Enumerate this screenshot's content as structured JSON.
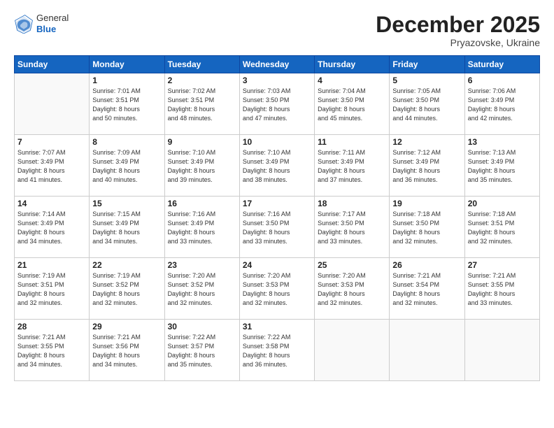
{
  "header": {
    "logo": {
      "general": "General",
      "blue": "Blue"
    },
    "title": "December 2025",
    "location": "Pryazovske, Ukraine"
  },
  "weekdays": [
    "Sunday",
    "Monday",
    "Tuesday",
    "Wednesday",
    "Thursday",
    "Friday",
    "Saturday"
  ],
  "weeks": [
    [
      {
        "day": "",
        "info": ""
      },
      {
        "day": "1",
        "info": "Sunrise: 7:01 AM\nSunset: 3:51 PM\nDaylight: 8 hours\nand 50 minutes."
      },
      {
        "day": "2",
        "info": "Sunrise: 7:02 AM\nSunset: 3:51 PM\nDaylight: 8 hours\nand 48 minutes."
      },
      {
        "day": "3",
        "info": "Sunrise: 7:03 AM\nSunset: 3:50 PM\nDaylight: 8 hours\nand 47 minutes."
      },
      {
        "day": "4",
        "info": "Sunrise: 7:04 AM\nSunset: 3:50 PM\nDaylight: 8 hours\nand 45 minutes."
      },
      {
        "day": "5",
        "info": "Sunrise: 7:05 AM\nSunset: 3:50 PM\nDaylight: 8 hours\nand 44 minutes."
      },
      {
        "day": "6",
        "info": "Sunrise: 7:06 AM\nSunset: 3:49 PM\nDaylight: 8 hours\nand 42 minutes."
      }
    ],
    [
      {
        "day": "7",
        "info": "Sunrise: 7:07 AM\nSunset: 3:49 PM\nDaylight: 8 hours\nand 41 minutes."
      },
      {
        "day": "8",
        "info": "Sunrise: 7:09 AM\nSunset: 3:49 PM\nDaylight: 8 hours\nand 40 minutes."
      },
      {
        "day": "9",
        "info": "Sunrise: 7:10 AM\nSunset: 3:49 PM\nDaylight: 8 hours\nand 39 minutes."
      },
      {
        "day": "10",
        "info": "Sunrise: 7:10 AM\nSunset: 3:49 PM\nDaylight: 8 hours\nand 38 minutes."
      },
      {
        "day": "11",
        "info": "Sunrise: 7:11 AM\nSunset: 3:49 PM\nDaylight: 8 hours\nand 37 minutes."
      },
      {
        "day": "12",
        "info": "Sunrise: 7:12 AM\nSunset: 3:49 PM\nDaylight: 8 hours\nand 36 minutes."
      },
      {
        "day": "13",
        "info": "Sunrise: 7:13 AM\nSunset: 3:49 PM\nDaylight: 8 hours\nand 35 minutes."
      }
    ],
    [
      {
        "day": "14",
        "info": "Sunrise: 7:14 AM\nSunset: 3:49 PM\nDaylight: 8 hours\nand 34 minutes."
      },
      {
        "day": "15",
        "info": "Sunrise: 7:15 AM\nSunset: 3:49 PM\nDaylight: 8 hours\nand 34 minutes."
      },
      {
        "day": "16",
        "info": "Sunrise: 7:16 AM\nSunset: 3:49 PM\nDaylight: 8 hours\nand 33 minutes."
      },
      {
        "day": "17",
        "info": "Sunrise: 7:16 AM\nSunset: 3:50 PM\nDaylight: 8 hours\nand 33 minutes."
      },
      {
        "day": "18",
        "info": "Sunrise: 7:17 AM\nSunset: 3:50 PM\nDaylight: 8 hours\nand 33 minutes."
      },
      {
        "day": "19",
        "info": "Sunrise: 7:18 AM\nSunset: 3:50 PM\nDaylight: 8 hours\nand 32 minutes."
      },
      {
        "day": "20",
        "info": "Sunrise: 7:18 AM\nSunset: 3:51 PM\nDaylight: 8 hours\nand 32 minutes."
      }
    ],
    [
      {
        "day": "21",
        "info": "Sunrise: 7:19 AM\nSunset: 3:51 PM\nDaylight: 8 hours\nand 32 minutes."
      },
      {
        "day": "22",
        "info": "Sunrise: 7:19 AM\nSunset: 3:52 PM\nDaylight: 8 hours\nand 32 minutes."
      },
      {
        "day": "23",
        "info": "Sunrise: 7:20 AM\nSunset: 3:52 PM\nDaylight: 8 hours\nand 32 minutes."
      },
      {
        "day": "24",
        "info": "Sunrise: 7:20 AM\nSunset: 3:53 PM\nDaylight: 8 hours\nand 32 minutes."
      },
      {
        "day": "25",
        "info": "Sunrise: 7:20 AM\nSunset: 3:53 PM\nDaylight: 8 hours\nand 32 minutes."
      },
      {
        "day": "26",
        "info": "Sunrise: 7:21 AM\nSunset: 3:54 PM\nDaylight: 8 hours\nand 32 minutes."
      },
      {
        "day": "27",
        "info": "Sunrise: 7:21 AM\nSunset: 3:55 PM\nDaylight: 8 hours\nand 33 minutes."
      }
    ],
    [
      {
        "day": "28",
        "info": "Sunrise: 7:21 AM\nSunset: 3:55 PM\nDaylight: 8 hours\nand 34 minutes."
      },
      {
        "day": "29",
        "info": "Sunrise: 7:21 AM\nSunset: 3:56 PM\nDaylight: 8 hours\nand 34 minutes."
      },
      {
        "day": "30",
        "info": "Sunrise: 7:22 AM\nSunset: 3:57 PM\nDaylight: 8 hours\nand 35 minutes."
      },
      {
        "day": "31",
        "info": "Sunrise: 7:22 AM\nSunset: 3:58 PM\nDaylight: 8 hours\nand 36 minutes."
      },
      {
        "day": "",
        "info": ""
      },
      {
        "day": "",
        "info": ""
      },
      {
        "day": "",
        "info": ""
      }
    ]
  ]
}
